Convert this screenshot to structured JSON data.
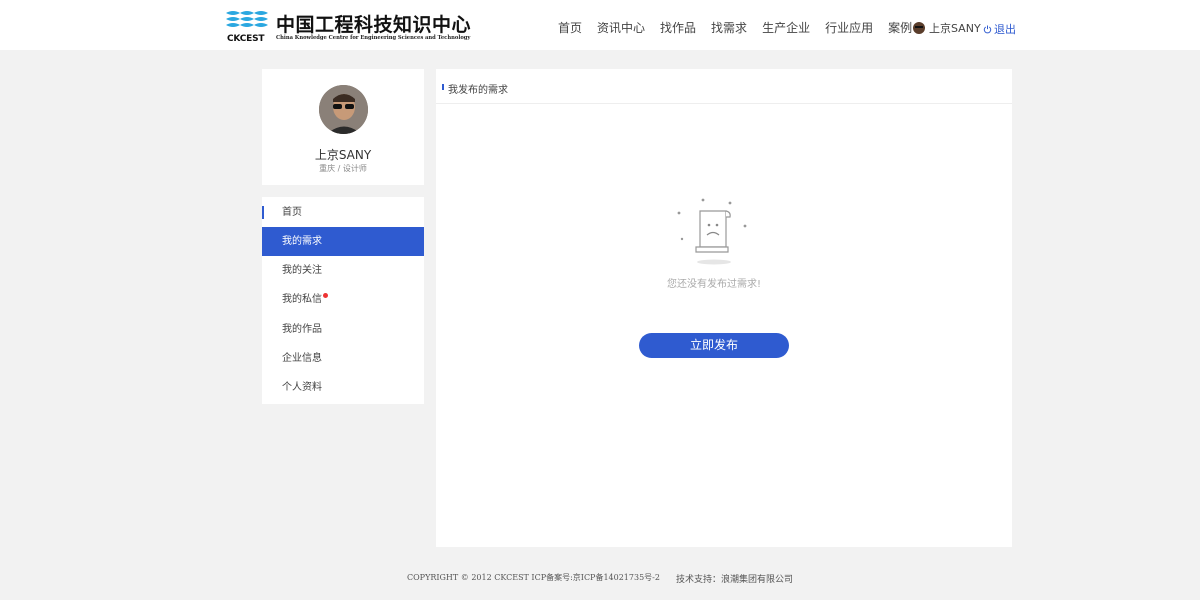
{
  "header": {
    "logo_cn": "中国工程科技知识中心",
    "logo_en": "China Knowledge Centre for Engineering Sciences and Technology",
    "logo_abbr": "CKCEST",
    "nav": [
      "首页",
      "资讯中心",
      "找作品",
      "找需求",
      "生产企业",
      "行业应用",
      "案例"
    ],
    "user_name": "上京SANY",
    "logout_label": "退出",
    "accent_color": "#2f5bd0"
  },
  "profile": {
    "name": "上京SANY",
    "subtitle": "重庆 / 设计师"
  },
  "menu": {
    "items": [
      {
        "label": "首页"
      },
      {
        "label": "我的需求"
      },
      {
        "label": "我的关注"
      },
      {
        "label": "我的私信"
      },
      {
        "label": "我的作品"
      },
      {
        "label": "企业信息"
      },
      {
        "label": "个人资料"
      }
    ],
    "active_index": 1,
    "unread_dot_color": "#e33333"
  },
  "main": {
    "title": "我发布的需求",
    "empty_text": "您还没有发布过需求!",
    "publish_label": "立即发布"
  },
  "footer": {
    "copyright": "COPYRIGHT © 2012 CKCEST ICP备案号:京ICP备14021735号-2",
    "support": "技术支持：浪潮集团有限公司"
  }
}
